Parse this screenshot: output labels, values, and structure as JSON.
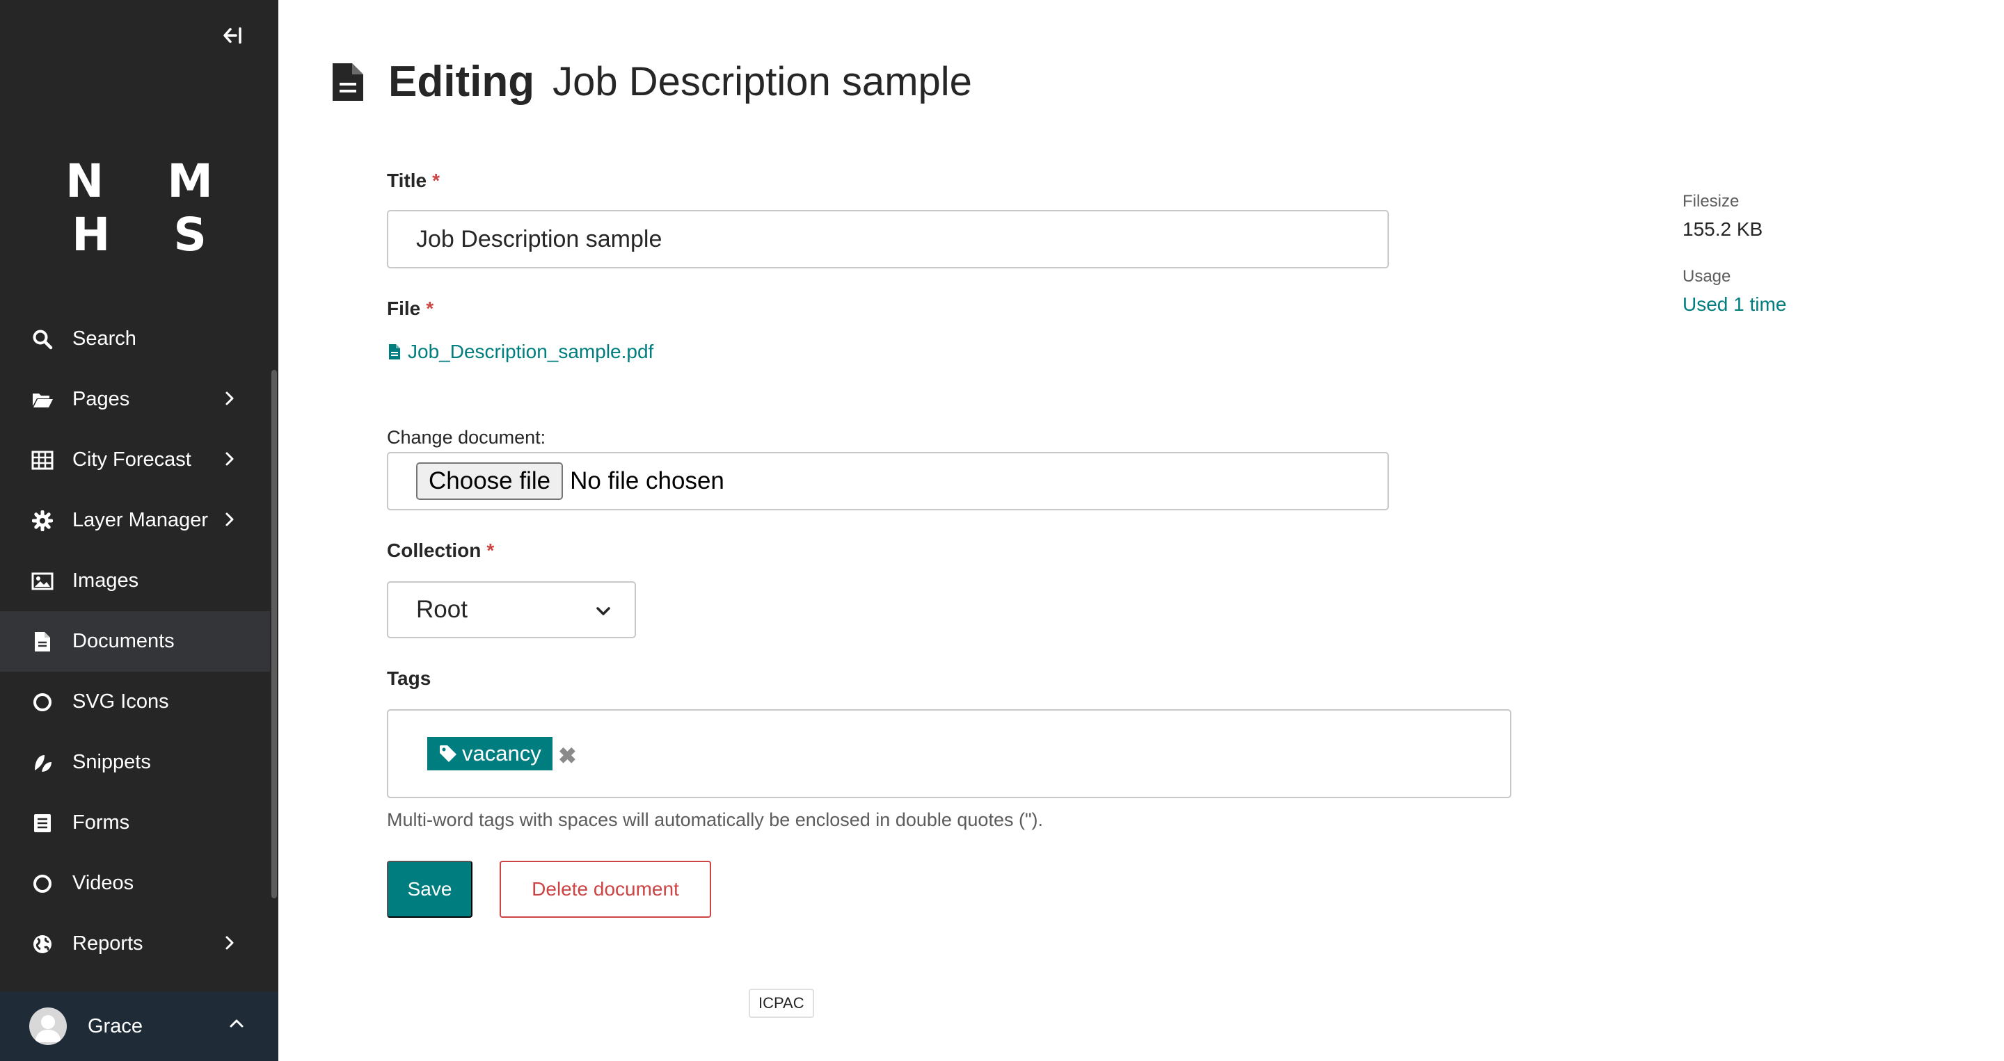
{
  "sidebar": {
    "logo": "N M H S",
    "collapse_icon": "collapse-left-icon",
    "items": [
      {
        "label": "Search",
        "icon": "search-icon",
        "has_submenu": false
      },
      {
        "label": "Pages",
        "icon": "folder-open-icon",
        "has_submenu": true
      },
      {
        "label": "City Forecast",
        "icon": "table-icon",
        "has_submenu": true
      },
      {
        "label": "Layer Manager",
        "icon": "cog-icon",
        "has_submenu": true
      },
      {
        "label": "Images",
        "icon": "image-icon",
        "has_submenu": false
      },
      {
        "label": "Documents",
        "icon": "document-icon",
        "has_submenu": false,
        "active": true
      },
      {
        "label": "SVG Icons",
        "icon": "circle-icon",
        "has_submenu": false
      },
      {
        "label": "Snippets",
        "icon": "snippet-icon",
        "has_submenu": false
      },
      {
        "label": "Forms",
        "icon": "form-icon",
        "has_submenu": false
      },
      {
        "label": "Videos",
        "icon": "circle-icon",
        "has_submenu": false
      },
      {
        "label": "Reports",
        "icon": "globe-icon",
        "has_submenu": true
      }
    ],
    "account": {
      "name": "Grace"
    }
  },
  "header": {
    "verb": "Editing",
    "title": "Job Description sample"
  },
  "form": {
    "title_label": "Title",
    "title_value": "Job Description sample",
    "file_label": "File",
    "file_name": "Job_Description_sample.pdf",
    "change_label": "Change document:",
    "choose_button": "Choose file",
    "no_file": "No file chosen",
    "collection_label": "Collection",
    "collection_value": "Root",
    "tags_label": "Tags",
    "tags": [
      "vacancy"
    ],
    "tags_help": "Multi-word tags with spaces will automatically be enclosed in double quotes (\").",
    "save_label": "Save",
    "delete_label": "Delete document",
    "required_marker": "*"
  },
  "info": {
    "filesize_label": "Filesize",
    "filesize_value": "155.2 KB",
    "usage_label": "Usage",
    "usage_value": "Used 1 time"
  },
  "tooltip": "ICPAC",
  "colors": {
    "sidebar_bg": "#262626",
    "accent": "#007d7e",
    "danger": "#cd4444"
  }
}
